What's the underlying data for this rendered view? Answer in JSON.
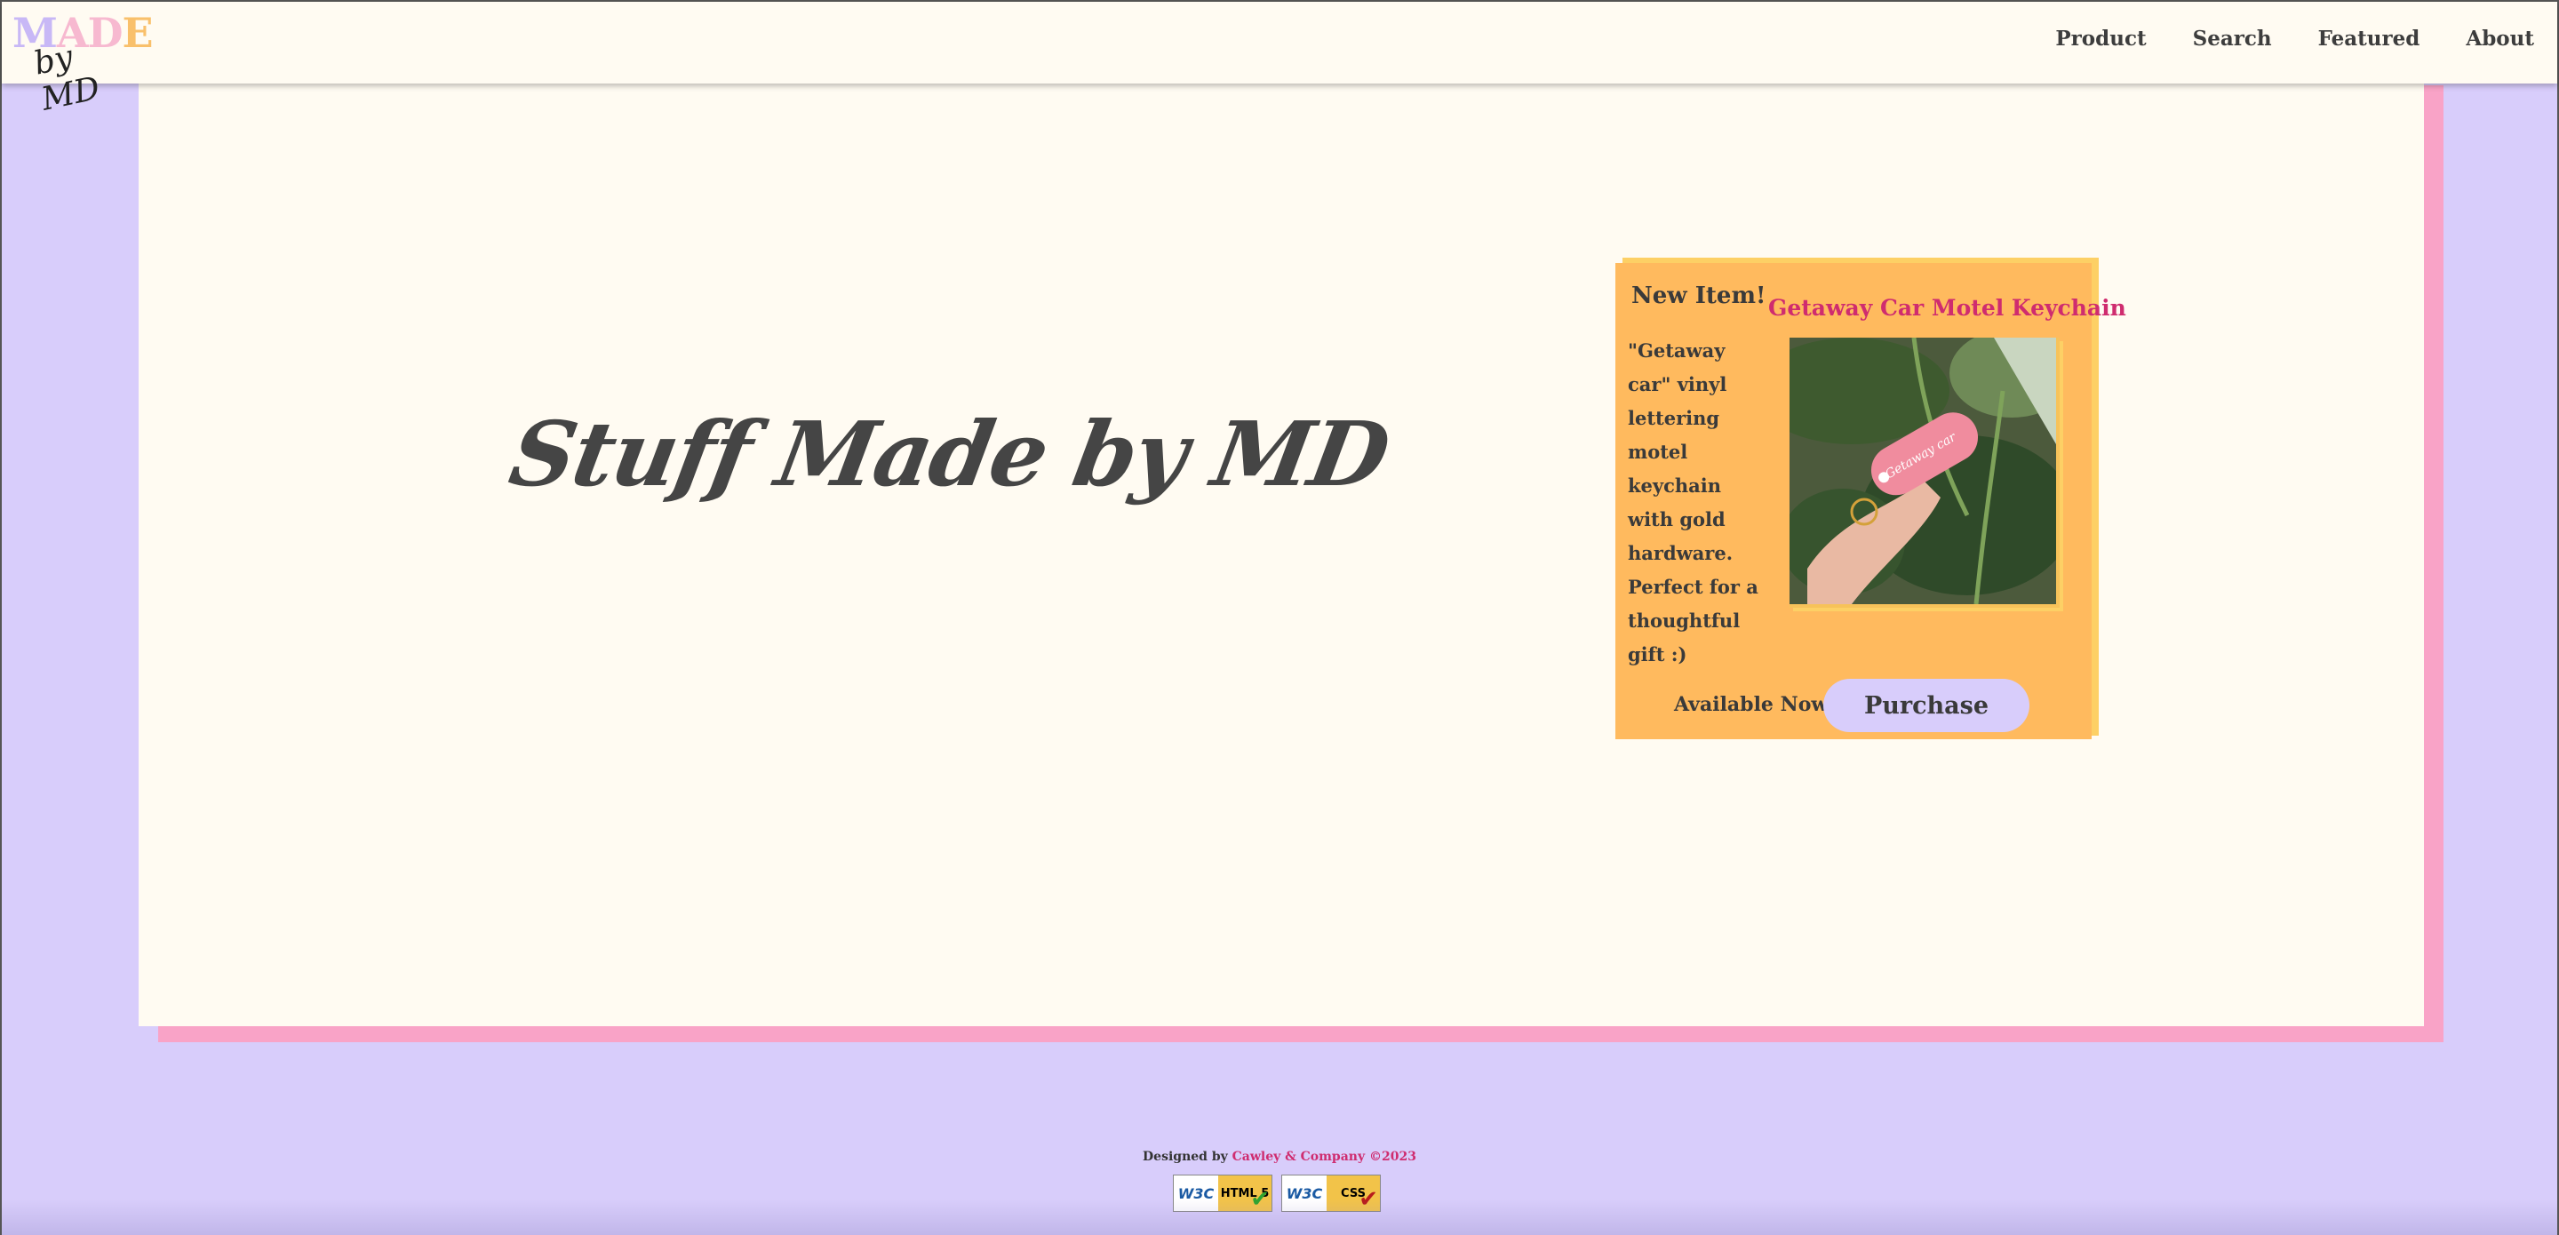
{
  "header": {
    "logo_made": "MADE",
    "logo_by": "by MD",
    "nav": [
      "Product",
      "Search",
      "Featured",
      "About"
    ]
  },
  "hero": {
    "title": "Stuff Made by MD"
  },
  "card": {
    "new_item": "New Item!",
    "item_name": "Getaway Car Motel Keychain",
    "description": "\"Getaway car\" vinyl lettering motel keychain with gold hardware. Perfect for a thoughtful gift :)",
    "available": "Available Now!",
    "purchase_label": "Purchase",
    "photo_text": "Getaway car"
  },
  "footer": {
    "designed_by": "Designed by",
    "company": "Cawley & Company ©2023",
    "badge_html_label": "HTML 5",
    "badge_css_label": "CSS",
    "badge_w3c": "W3C"
  },
  "colors": {
    "background": "#d8cdfb",
    "panel": "#fffbf2",
    "panel_shadow": "#f9a3c7",
    "card": "#ffba5e",
    "accent": "#cf2c6f",
    "button": "#d8cdfb"
  },
  "icons": [
    "w3c-html5-badge-icon",
    "w3c-css-badge-icon",
    "checkmark-icon"
  ]
}
